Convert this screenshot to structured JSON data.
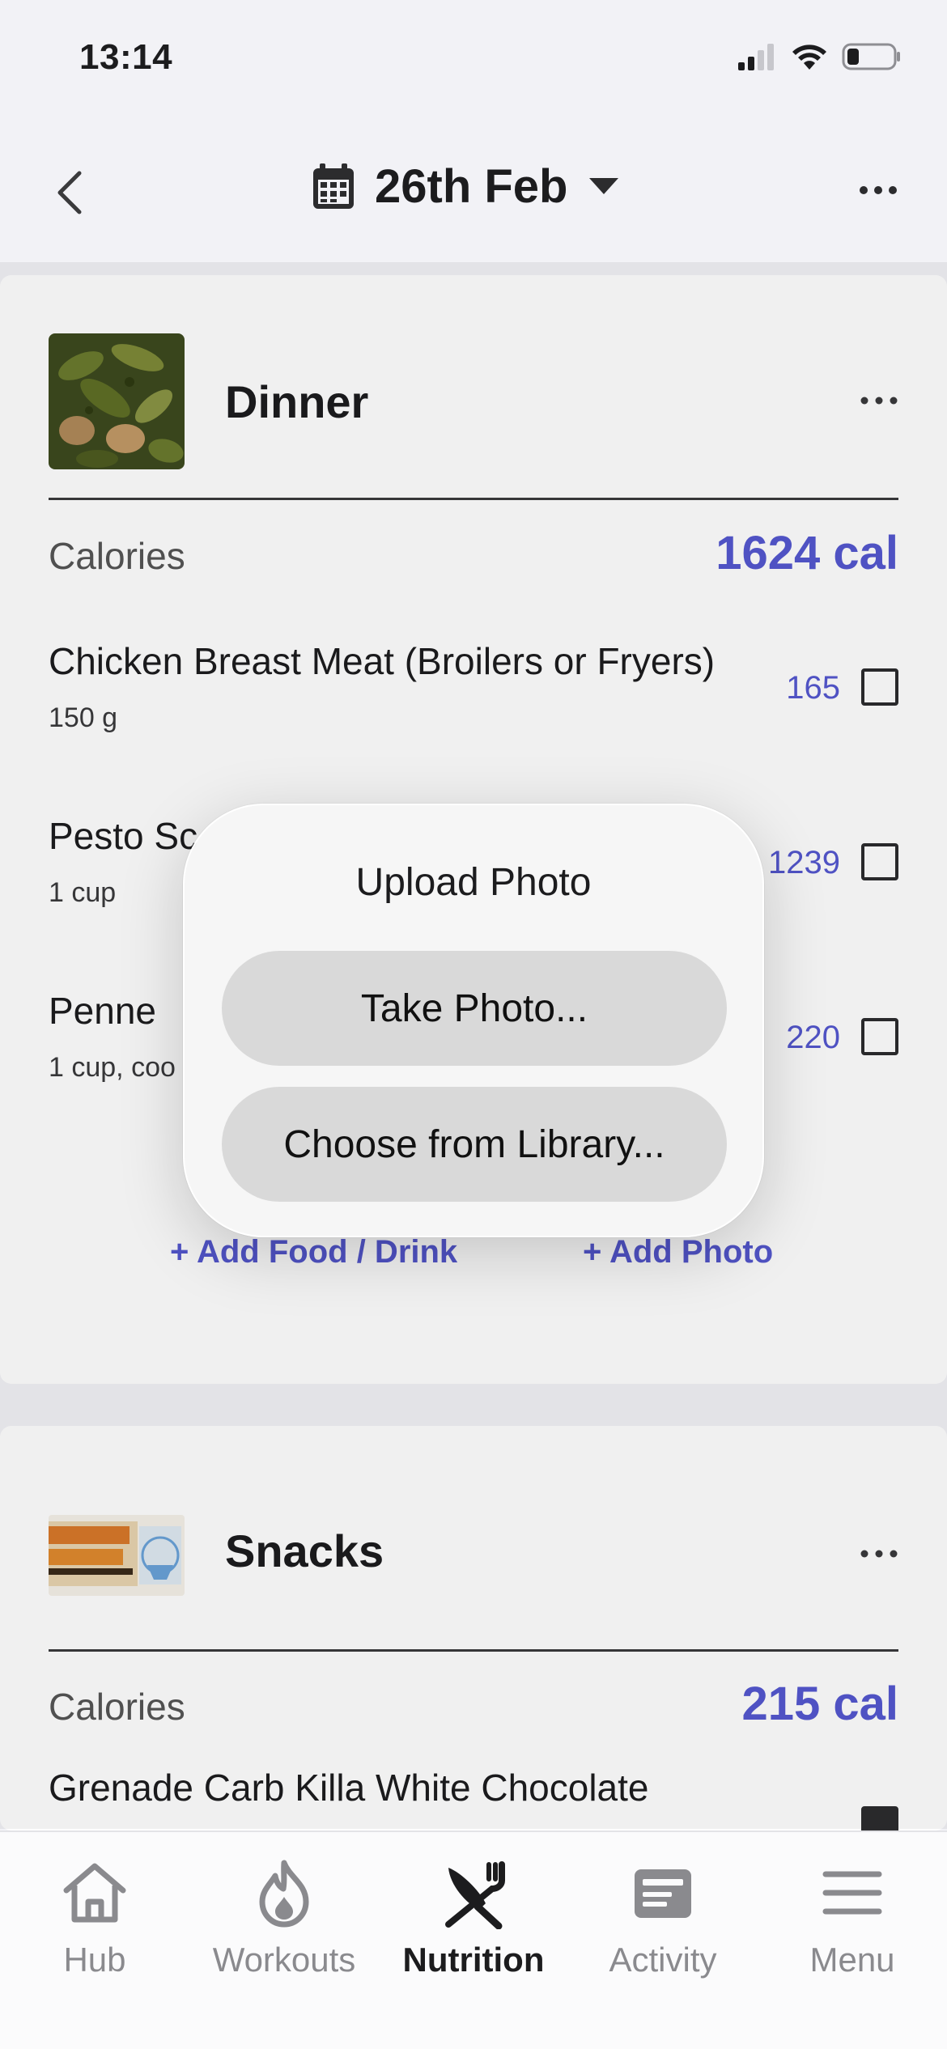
{
  "status_bar": {
    "time": "13:14"
  },
  "header": {
    "date": "26th Feb"
  },
  "meals": [
    {
      "title": "Dinner",
      "calories_label": "Calories",
      "calories_value": "1624 cal",
      "items": [
        {
          "name": "Chicken Breast Meat (Broilers or Fryers)",
          "qty": "150 g",
          "cal": "165",
          "checked": false
        },
        {
          "name": "Pesto Sc",
          "qty": "1 cup",
          "cal": "1239",
          "checked": false
        },
        {
          "name": "Penne",
          "qty": "1 cup, coo",
          "cal": "220",
          "checked": false
        }
      ],
      "add_food": "+ Add Food / Drink",
      "add_photo": "+ Add Photo"
    },
    {
      "title": "Snacks",
      "calories_label": "Calories",
      "calories_value": "215 cal",
      "items": [
        {
          "name": "Grenade Carb Killa White Chocolate",
          "qty": "",
          "cal": "",
          "checked": true
        }
      ]
    }
  ],
  "popup": {
    "title": "Upload Photo",
    "take_photo": "Take Photo...",
    "choose_library": "Choose from Library..."
  },
  "tabs": [
    {
      "label": "Hub",
      "icon": "home-icon",
      "active": false
    },
    {
      "label": "Workouts",
      "icon": "flame-icon",
      "active": false
    },
    {
      "label": "Nutrition",
      "icon": "fork-knife-icon",
      "active": true
    },
    {
      "label": "Activity",
      "icon": "newspaper-icon",
      "active": false
    },
    {
      "label": "Menu",
      "icon": "hamburger-icon",
      "active": false
    }
  ],
  "colors": {
    "accent": "#5458d0",
    "background": "#f2f2f6"
  }
}
